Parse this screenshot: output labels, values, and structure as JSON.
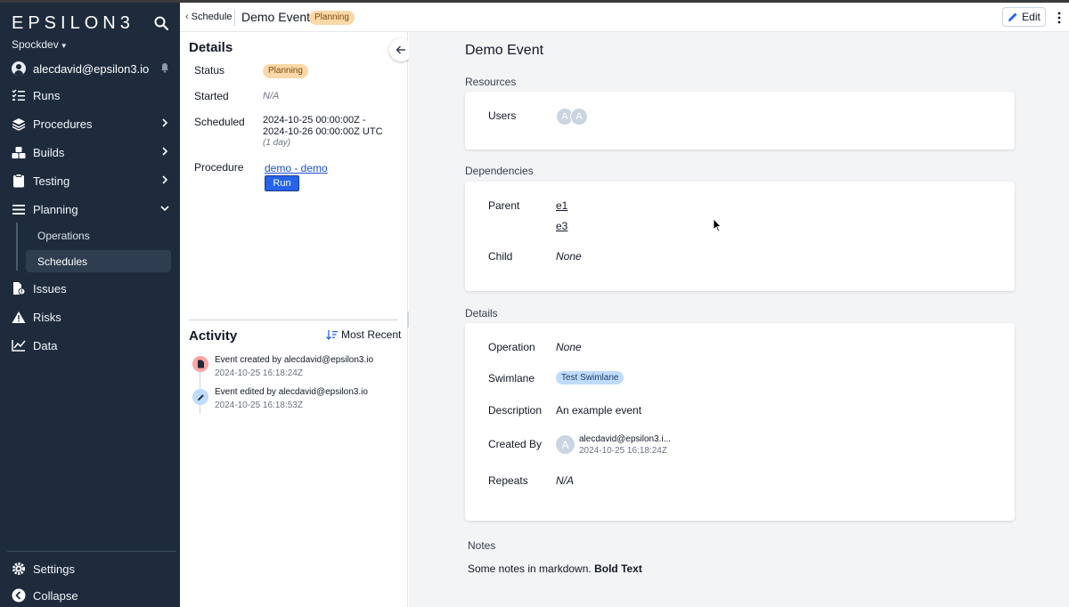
{
  "app": {
    "logo": "EPSILON3",
    "workspace": "Spockdev",
    "user_email": "alecdavid@epsilon3.io"
  },
  "sidebar": {
    "items": [
      {
        "label": "Runs",
        "icon": "runs-checklist-icon"
      },
      {
        "label": "Procedures",
        "icon": "layers-icon"
      },
      {
        "label": "Builds",
        "icon": "cubes-icon"
      },
      {
        "label": "Testing",
        "icon": "clipboard-icon"
      },
      {
        "label": "Planning",
        "icon": "bars-icon"
      },
      {
        "label": "Issues",
        "icon": "file-alert-icon"
      },
      {
        "label": "Risks",
        "icon": "warning-icon"
      },
      {
        "label": "Data",
        "icon": "line-chart-icon"
      }
    ],
    "planning_sub": [
      {
        "label": "Operations"
      },
      {
        "label": "Schedules"
      }
    ],
    "settings": "Settings",
    "collapse": "Collapse"
  },
  "topbar": {
    "breadcrumb": "Schedule",
    "title": "Demo Event",
    "status": "Planning",
    "edit_label": "Edit"
  },
  "details": {
    "heading": "Details",
    "status_label": "Status",
    "status_value": "Planning",
    "started_label": "Started",
    "started_value": "N/A",
    "scheduled_label": "Scheduled",
    "scheduled_line1": "2024-10-25 00:00:00Z -",
    "scheduled_line2": "2024-10-26 00:00:00Z UTC",
    "scheduled_duration": "(1 day)",
    "procedure_label": "Procedure",
    "procedure_link": "demo - demo",
    "run_label": "Run"
  },
  "activity": {
    "heading": "Activity",
    "sort_label": "Most Recent",
    "items": [
      {
        "text": "Event created by alecdavid@epsilon3.io",
        "time": "2024-10-25 16:18:24Z",
        "icon": "file-icon"
      },
      {
        "text": "Event edited by alecdavid@epsilon3.io",
        "time": "2024-10-25 16:18:53Z",
        "icon": "pencil-icon"
      }
    ]
  },
  "main": {
    "title": "Demo Event",
    "resources": {
      "heading": "Resources",
      "users_label": "Users",
      "avatars": [
        "A",
        "A"
      ]
    },
    "dependencies": {
      "heading": "Dependencies",
      "parent_label": "Parent",
      "parents": [
        "e1",
        "e3"
      ],
      "child_label": "Child",
      "child_value": "None"
    },
    "details": {
      "heading": "Details",
      "operation_label": "Operation",
      "operation_value": "None",
      "swimlane_label": "Swimlane",
      "swimlane_value": "Test Swimlane",
      "description_label": "Description",
      "description_value": "An example event",
      "created_by_label": "Created By",
      "created_by_avatar": "A",
      "created_by_name": "alecdavid@epsilon3.i...",
      "created_by_time": "2024-10-25 16:18:24Z",
      "repeats_label": "Repeats",
      "repeats_value": "N/A"
    },
    "notes": {
      "heading": "Notes",
      "text": "Some notes in markdown. ",
      "bold": "Bold Text"
    }
  },
  "colors": {
    "sidebar_bg": "#1e2b3c",
    "planning_badge": "#fcd8a8",
    "swimlane_badge": "#bfdbfe",
    "run_button": "#2563eb"
  }
}
